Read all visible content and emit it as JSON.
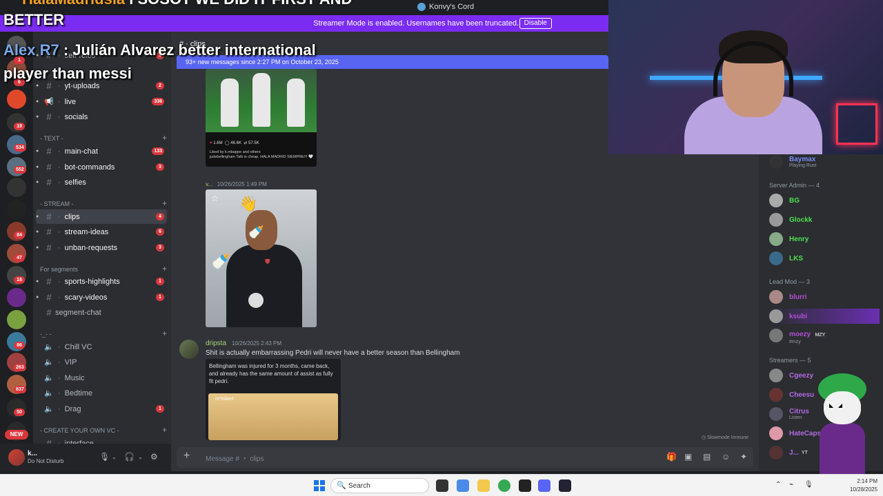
{
  "window": {
    "app_name": "Konvy's Cord"
  },
  "streamer_banner": {
    "message": "Streamer Mode is enabled. Usernames have been truncated.",
    "disable_label": "Disable"
  },
  "overlay": {
    "top_cut_prefix": "HalaMadridsia",
    "top_cut_text": " I SOSOT WE DID IT FIRST AND",
    "line1": "BETTER",
    "comment_user": "Alex R7",
    "comment_text": " : Julián Alvarez better international player than messi"
  },
  "rail": {
    "badges": [
      "1",
      "6",
      "19",
      "534",
      "552",
      "84",
      "47",
      "18",
      "86",
      "263",
      "837",
      "50"
    ],
    "new_label": "NEW"
  },
  "sidebar": {
    "server_name": "Konvy's Cord",
    "channels_top": [
      {
        "name": "self-roles",
        "badge": "3",
        "icon": "#"
      },
      {
        "name": "yt-uploads",
        "badge": "2",
        "icon": "#"
      },
      {
        "name": "live",
        "badge": "336",
        "icon": "megaphone"
      },
      {
        "name": "socials",
        "badge": "",
        "icon": "#"
      }
    ],
    "cat_text": "- TEXT -",
    "channels_text": [
      {
        "name": "main-chat",
        "badge": "133"
      },
      {
        "name": "bot-commands",
        "badge": "3"
      },
      {
        "name": "selfies",
        "badge": ""
      }
    ],
    "cat_stream": "- STREAM -",
    "channels_stream": [
      {
        "name": "clips",
        "badge": "4"
      },
      {
        "name": "stream-ideas",
        "badge": "6"
      },
      {
        "name": "unban-requests",
        "badge": "3"
      }
    ],
    "cat_segments": "For segments",
    "channels_segments": [
      {
        "name": "sports-highlights",
        "badge": "1"
      },
      {
        "name": "scary-videos",
        "badge": "1"
      },
      {
        "name": "segment-chat",
        "badge": ""
      }
    ],
    "cat_voice": "-_- -",
    "voice_channels": [
      {
        "name": "Chill VC",
        "badge": ""
      },
      {
        "name": "VIP",
        "badge": ""
      },
      {
        "name": "Music",
        "badge": ""
      },
      {
        "name": "Bedtime",
        "badge": ""
      },
      {
        "name": "Drag",
        "badge": "1"
      }
    ],
    "cat_create": "- CREATE YOUR OWN VC -",
    "last_partial": "interface"
  },
  "user_panel": {
    "name": "k...",
    "status": "Do Not Disturb"
  },
  "chat": {
    "channel": "clips",
    "new_messages": "93+ new messages since 2:27 PM on October 23, 2025",
    "ig_post": {
      "likes": "1.6M",
      "comments": "46.6K",
      "shares": "57.5K",
      "liked_by": "Liked by k.mbappe and others",
      "caption": "judebellingham Talk is cheap. HALA MADRID SIEMPRE!!! 🤍"
    },
    "msg1": {
      "author": "v...",
      "time": "10/26/2025 1:49 PM"
    },
    "msg2": {
      "author": "dripsta",
      "time": "10/26/2025 2:43 PM",
      "text": "Shit is actually embarrassing Pedri will never have a better season than Bellingham",
      "embed_text": "Bellingham was injured for 3 months, came back, and already has the same amount of assist as fully fit pedri.",
      "embed_img_label": "m*mbert"
    },
    "slowmode": "Slowmode Immune",
    "composer_placeholder": "Message # ・ clips"
  },
  "members": {
    "top_member": {
      "name": "Baymax",
      "sub": "Playing Rust"
    },
    "groups": [
      {
        "title": "Server Admin — 4",
        "members": [
          {
            "name": "BG",
            "color": "#4ee04e"
          },
          {
            "name": "Glockk",
            "color": "#4ee04e"
          },
          {
            "name": "Henry",
            "color": "#4ee04e"
          },
          {
            "name": "LKS",
            "color": "#4ee04e"
          }
        ]
      },
      {
        "title": "Lead Mod — 3",
        "members": [
          {
            "name": "blurri",
            "color": "#b24fd6"
          },
          {
            "name": "ksubi",
            "color": "#b24fd6"
          },
          {
            "name": "moezy",
            "color": "#b24fd6",
            "tag": "MZY",
            "sub": "#mzy"
          }
        ]
      },
      {
        "title": "Streamers — 5",
        "members": [
          {
            "name": "Cgeezy",
            "color": "#b36ae2"
          },
          {
            "name": "Cheesu",
            "color": "#b36ae2"
          },
          {
            "name": "Citrus",
            "color": "#b36ae2",
            "sub": "Listen"
          },
          {
            "name": "HateCaps",
            "color": "#b36ae2"
          },
          {
            "name": "J...",
            "color": "#b36ae2",
            "tag": "YT"
          }
        ]
      }
    ]
  },
  "taskbar": {
    "search_label": "Search",
    "time": "2:14 PM",
    "date": "10/28/2025"
  }
}
